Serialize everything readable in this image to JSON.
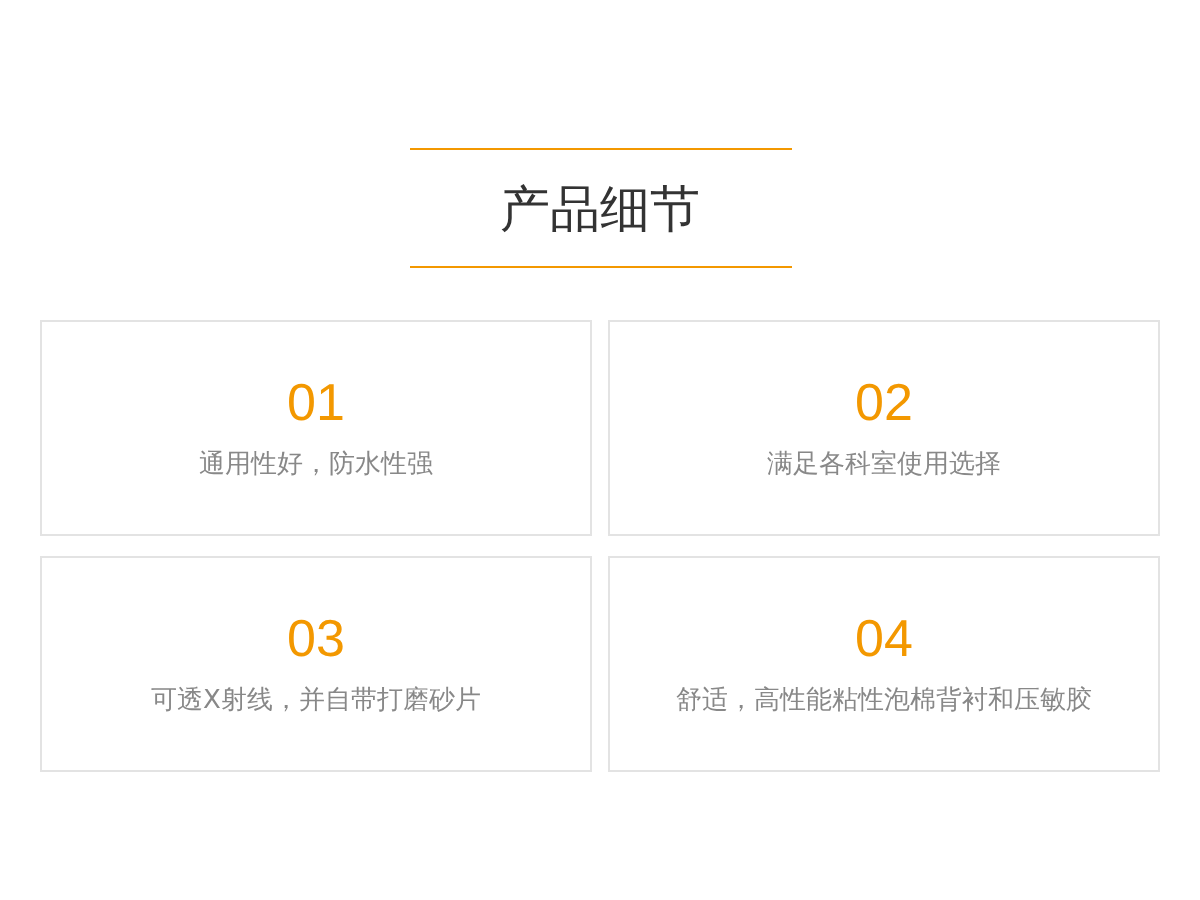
{
  "title": "产品细节",
  "features": [
    {
      "number": "01",
      "text": "通用性好，防水性强"
    },
    {
      "number": "02",
      "text": "满足各科室使用选择"
    },
    {
      "number": "03",
      "text": "可透X射线，并自带打磨砂片"
    },
    {
      "number": "04",
      "text": "舒适，高性能粘性泡棉背衬和压敏胶"
    }
  ]
}
